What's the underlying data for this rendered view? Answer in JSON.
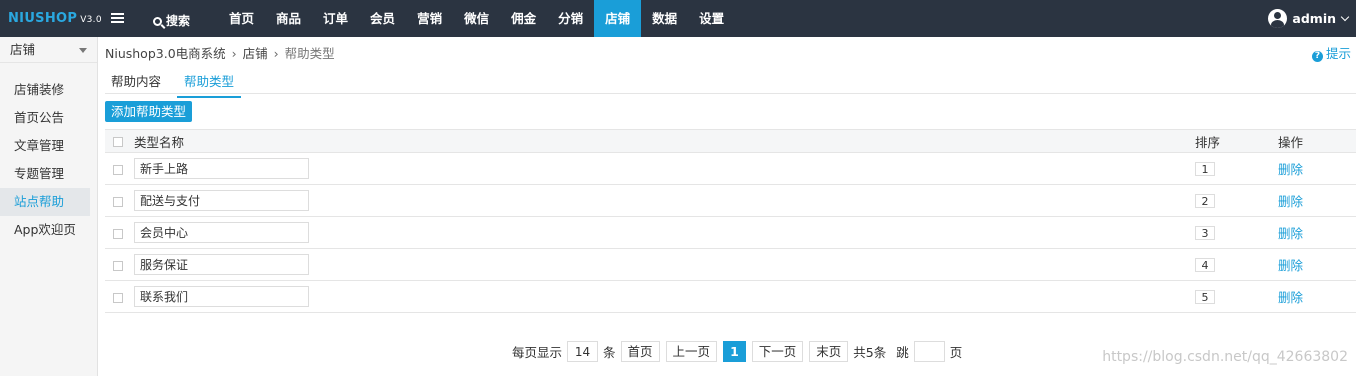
{
  "topbar": {
    "logo_brand": "NIUSHOP",
    "logo_version": "V3.0",
    "search_label": "搜索",
    "nav": [
      "首页",
      "商品",
      "订单",
      "会员",
      "营销",
      "微信",
      "佣金",
      "分销",
      "店铺",
      "数据",
      "设置"
    ],
    "active_nav": "店铺",
    "user_name": "admin"
  },
  "sidebar": {
    "section_label": "店铺",
    "items": [
      "店铺装修",
      "首页公告",
      "文章管理",
      "专题管理",
      "站点帮助",
      "App欢迎页"
    ],
    "active_item": "站点帮助"
  },
  "breadcrumb": [
    "Niushop3.0电商系统",
    "店铺",
    "帮助类型"
  ],
  "hint_label": "提示",
  "tabs": [
    "帮助内容",
    "帮助类型"
  ],
  "active_tab": "帮助类型",
  "add_button_label": "添加帮助类型",
  "table": {
    "headers": {
      "name": "类型名称",
      "sort": "排序",
      "action": "操作"
    },
    "rows": [
      {
        "name": "新手上路",
        "sort": "1",
        "action": "删除"
      },
      {
        "name": "配送与支付",
        "sort": "2",
        "action": "删除"
      },
      {
        "name": "会员中心",
        "sort": "3",
        "action": "删除"
      },
      {
        "name": "服务保证",
        "sort": "4",
        "action": "删除"
      },
      {
        "name": "联系我们",
        "sort": "5",
        "action": "删除"
      }
    ]
  },
  "pagination": {
    "per_page_label": "每页显示",
    "per_page_value": "14",
    "per_page_unit": "条",
    "first": "首页",
    "prev": "上一页",
    "current": "1",
    "next": "下一页",
    "last": "末页",
    "total": "共5条",
    "jump_label": "跳",
    "jump_value": "",
    "page_unit": "页"
  },
  "watermark": "https://blog.csdn.net/qq_42663802",
  "colors": {
    "topbar_bg": "#2b3441",
    "accent": "#1a9ed8"
  }
}
